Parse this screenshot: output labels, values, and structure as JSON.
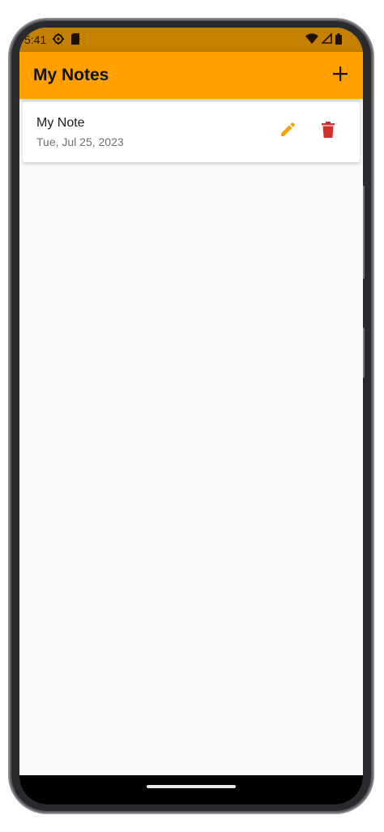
{
  "status_bar": {
    "time": "5:41",
    "left_icons": [
      "settings-icon",
      "sim-card-icon"
    ],
    "right_icons": [
      "wifi-icon",
      "signal-icon",
      "battery-icon"
    ]
  },
  "app_bar": {
    "title": "My Notes",
    "add_icon": "plus-icon",
    "background_color": "#ffa000"
  },
  "notes": [
    {
      "title": "My Note",
      "date": "Tue, Jul 25, 2023",
      "edit_icon": "pencil-icon",
      "edit_color": "#f5a300",
      "delete_icon": "trash-icon",
      "delete_color": "#d32f2f"
    }
  ]
}
